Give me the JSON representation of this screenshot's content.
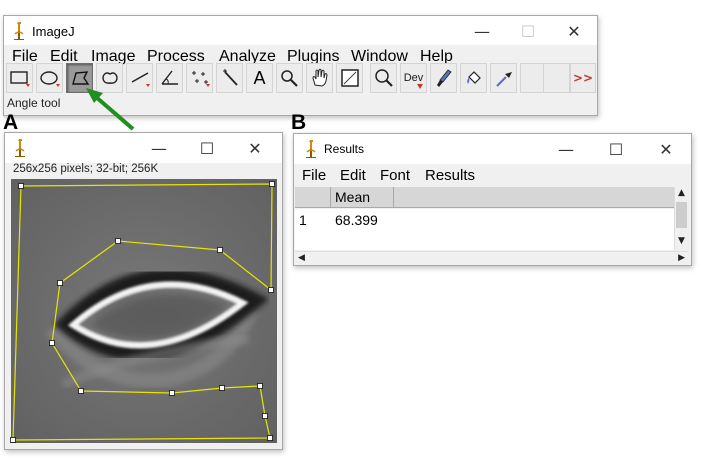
{
  "panel_labels": {
    "a": "A",
    "b": "B"
  },
  "imagej": {
    "title": "ImageJ",
    "window_controls": {
      "minimize": "—",
      "maximize": "☐",
      "close": "✕"
    },
    "menu": [
      "File",
      "Edit",
      "Image",
      "Process",
      "Analyze",
      "Plugins",
      "Window",
      "Help"
    ],
    "tools": [
      {
        "name": "rectangle-tool-icon"
      },
      {
        "name": "oval-tool-icon"
      },
      {
        "name": "polygon-tool-icon",
        "selected": true
      },
      {
        "name": "freehand-tool-icon"
      },
      {
        "name": "line-tool-icon"
      },
      {
        "name": "angle-tool-icon"
      },
      {
        "name": "multipoint-tool-icon"
      },
      {
        "name": "wand-tool-icon"
      },
      {
        "name": "text-tool-icon",
        "label": "A"
      },
      {
        "name": "magnifier-icon"
      },
      {
        "name": "scroll-hand-icon"
      },
      {
        "name": "color-picker-icon"
      },
      {
        "name": "zoom-icon"
      },
      {
        "name": "developer-menu-icon",
        "label": "Dev"
      },
      {
        "name": "brush-icon"
      },
      {
        "name": "flood-fill-icon"
      },
      {
        "name": "pipette-icon"
      },
      {
        "name": "empty-slot"
      },
      {
        "name": "empty-slot"
      },
      {
        "name": "more-tools-icon",
        "label": ">>"
      }
    ],
    "status_text": "Angle tool"
  },
  "image_window": {
    "window_controls": {
      "minimize": "—",
      "maximize": "☐",
      "close": "✕"
    },
    "info": "256x256 pixels; 32-bit; 256K"
  },
  "results": {
    "title": "Results",
    "window_controls": {
      "minimize": "—",
      "maximize": "☐",
      "close": "✕"
    },
    "menu": [
      "File",
      "Edit",
      "Font",
      "Results"
    ],
    "columns": [
      "",
      "Mean"
    ],
    "rows": [
      [
        "1",
        "68.399"
      ]
    ]
  },
  "colors": {
    "roi_line": "#e6e600",
    "arrow": "#1f8f1f",
    "accent_text": "#c0392b"
  }
}
